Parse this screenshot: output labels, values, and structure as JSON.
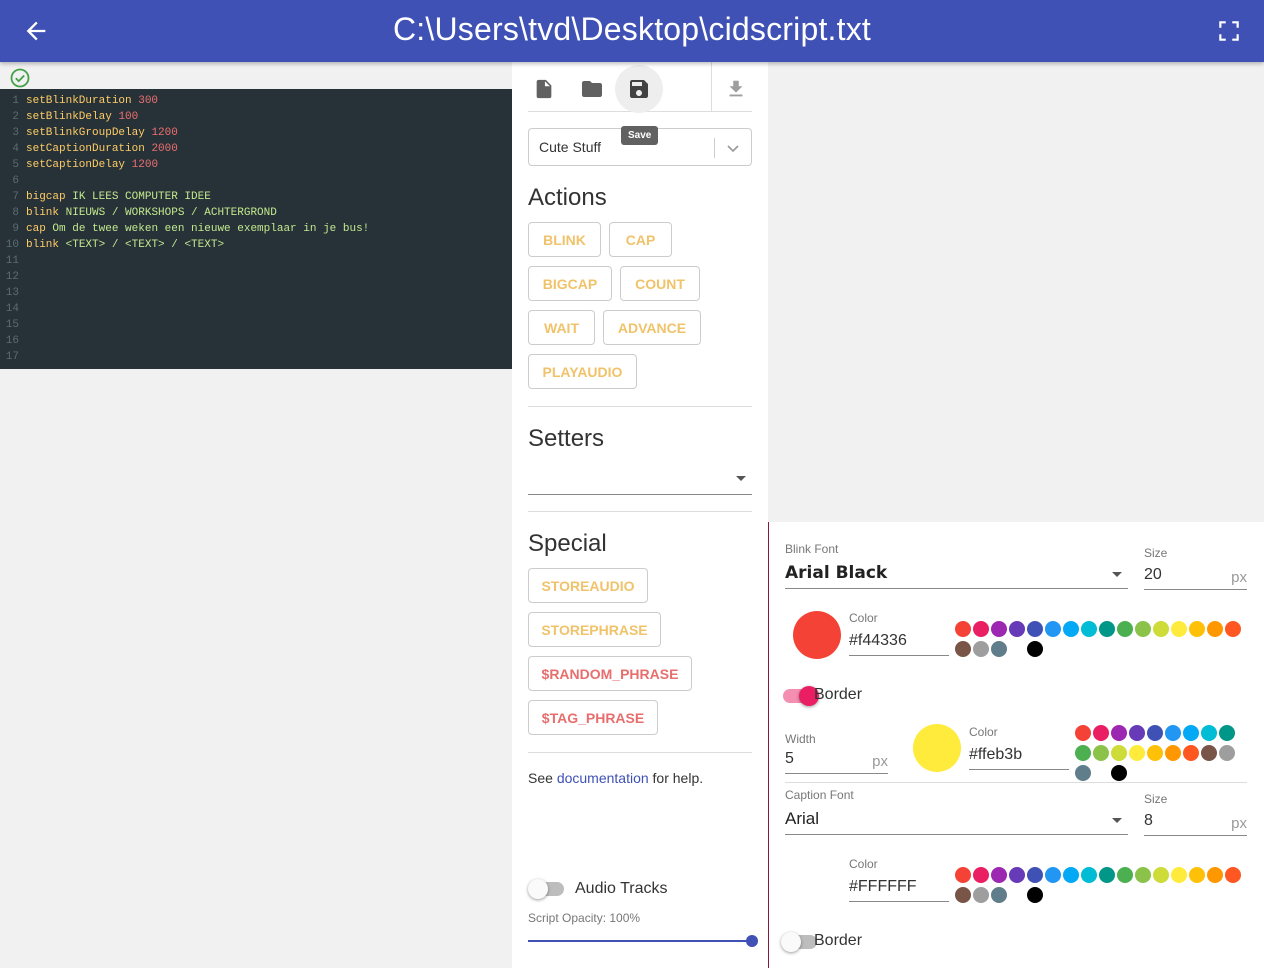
{
  "header": {
    "title": "C:\\Users\\tvd\\Desktop\\cidscript.txt"
  },
  "editor": {
    "lines": [
      {
        "n": "1",
        "kw": "setBlinkDuration",
        "num": "300",
        "txt": ""
      },
      {
        "n": "2",
        "kw": "setBlinkDelay",
        "num": "100",
        "txt": ""
      },
      {
        "n": "3",
        "kw": "setBlinkGroupDelay",
        "num": "1200",
        "txt": ""
      },
      {
        "n": "4",
        "kw": "setCaptionDuration",
        "num": "2000",
        "txt": ""
      },
      {
        "n": "5",
        "kw": "setCaptionDelay",
        "num": "1200",
        "txt": ""
      },
      {
        "n": "6",
        "kw": "",
        "num": "",
        "txt": ""
      },
      {
        "n": "7",
        "kw": "bigcap",
        "num": "",
        "txt": "IK LEES COMPUTER IDEE"
      },
      {
        "n": "8",
        "kw": "blink",
        "num": "",
        "txt": "NIEUWS / WORKSHOPS / ACHTERGROND"
      },
      {
        "n": "9",
        "kw": "cap",
        "num": "",
        "txt": "Om de twee weken een nieuwe exemplaar in je bus!"
      },
      {
        "n": "10",
        "kw": "blink",
        "num": "",
        "txt": "<TEXT> / <TEXT> / <TEXT>"
      },
      {
        "n": "11",
        "kw": "",
        "num": "",
        "txt": ""
      },
      {
        "n": "12",
        "kw": "",
        "num": "",
        "txt": ""
      },
      {
        "n": "13",
        "kw": "",
        "num": "",
        "txt": ""
      },
      {
        "n": "14",
        "kw": "",
        "num": "",
        "txt": ""
      },
      {
        "n": "15",
        "kw": "",
        "num": "",
        "txt": ""
      },
      {
        "n": "16",
        "kw": "",
        "num": "",
        "txt": ""
      },
      {
        "n": "17",
        "kw": "",
        "num": "",
        "txt": ""
      }
    ]
  },
  "toolbar": {
    "tooltip": "Save",
    "icons": [
      "new-file-icon",
      "open-folder-icon",
      "save-icon",
      "download-icon"
    ]
  },
  "template_select": {
    "value": "Cute Stuff"
  },
  "actions": {
    "heading": "Actions",
    "buttons": [
      "BLINK",
      "CAP",
      "BIGCAP",
      "COUNT",
      "WAIT",
      "ADVANCE",
      "PLAYAUDIO"
    ]
  },
  "setters": {
    "heading": "Setters",
    "value": ""
  },
  "special": {
    "heading": "Special",
    "buttons": [
      "STOREAUDIO",
      "STOREPHRASE",
      "$RANDOM_PHRASE",
      "$TAG_PHRASE"
    ]
  },
  "help": {
    "prefix": "See ",
    "link": "documentation",
    "suffix": " for help."
  },
  "audio_tracks": {
    "label": "Audio Tracks",
    "enabled": false
  },
  "opacity": {
    "label": "Script Opacity: 100%",
    "value": 1.0
  },
  "blink_font": {
    "label": "Blink Font",
    "value": "Arial Black",
    "size_label": "Size",
    "size": "20",
    "unit": "px",
    "color_label": "Color",
    "color": "#f44336",
    "border_label": "Border",
    "border_enabled": true,
    "width_label": "Width",
    "width": "5",
    "width_unit": "px",
    "border_color_label": "Color",
    "border_color": "#ffeb3b"
  },
  "caption_font": {
    "label": "Caption Font",
    "value": "Arial",
    "size_label": "Size",
    "size": "8",
    "unit": "px",
    "color_label": "Color",
    "color": "#FFFFFF",
    "border_label": "Border",
    "border_enabled": false
  },
  "palette_colors": [
    "#f44336",
    "#e91e63",
    "#9c27b0",
    "#673ab7",
    "#3f51b5",
    "#2196f3",
    "#03a9f4",
    "#00bcd4",
    "#009688",
    "#4caf50",
    "#8bc34a",
    "#cddc39",
    "#ffeb3b",
    "#ffc107",
    "#ff9800",
    "#ff5722",
    "#795548",
    "#9e9e9e",
    "#607d8b",
    "#ffffff",
    "#000000"
  ],
  "colors": {
    "primary": "#3f51b5",
    "editor_bg": "#263238",
    "accent_pink": "#e91e63"
  }
}
